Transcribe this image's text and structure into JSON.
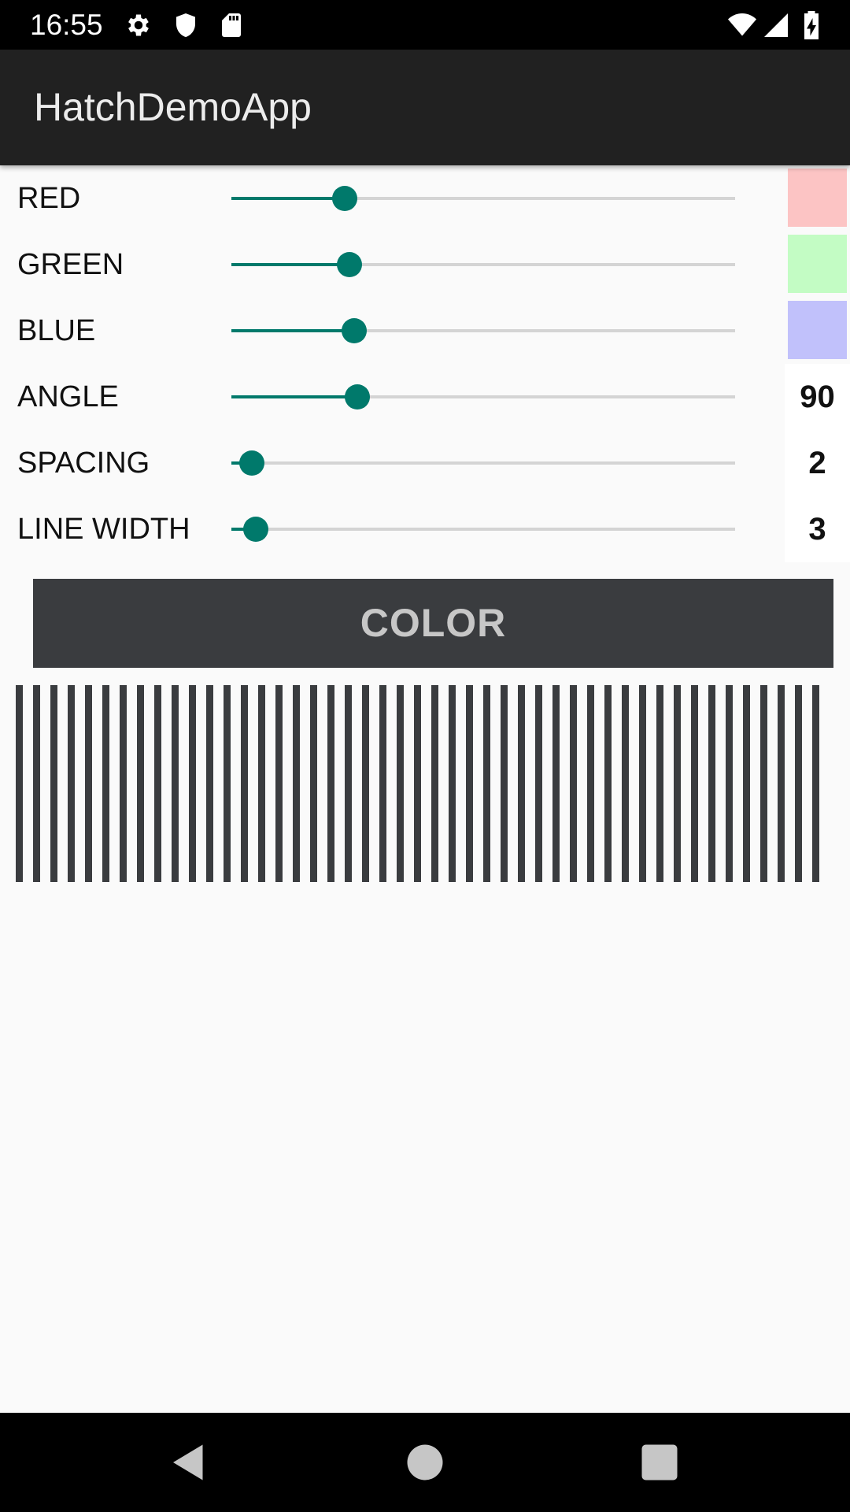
{
  "status_bar": {
    "time": "16:55",
    "left_icons": [
      "gear-icon",
      "shield-icon",
      "sd-card-icon"
    ],
    "right_icons": [
      "wifi-icon",
      "signal-icon",
      "battery-charging-icon"
    ]
  },
  "app_bar": {
    "title": "HatchDemoApp"
  },
  "colors": {
    "accent": "#00796b",
    "app_bar": "#212121",
    "button_bg": "#3a3c3f",
    "hatch_line": "#3a3c3f"
  },
  "sliders": [
    {
      "label": "RED",
      "level": 0.225,
      "swatch_color": "#fcc4c4",
      "value": ""
    },
    {
      "label": "GREEN",
      "level": 0.235,
      "swatch_color": "#c3fcc4",
      "value": ""
    },
    {
      "label": "BLUE",
      "level": 0.243,
      "swatch_color": "#c1c1fb",
      "value": ""
    },
    {
      "label": "ANGLE",
      "level": 0.25,
      "swatch_color": "",
      "value": "90"
    },
    {
      "label": "SPACING",
      "level": 0.04,
      "swatch_color": "",
      "value": "2"
    },
    {
      "label": "LINE WIDTH",
      "level": 0.048,
      "swatch_color": "",
      "value": "3"
    }
  ],
  "color_button": {
    "label": "COLOR"
  },
  "hatch": {
    "angle": 90,
    "spacing": 2,
    "line_width": 3
  },
  "nav_bar": {
    "buttons": [
      "back-icon",
      "home-icon",
      "recents-icon"
    ]
  }
}
